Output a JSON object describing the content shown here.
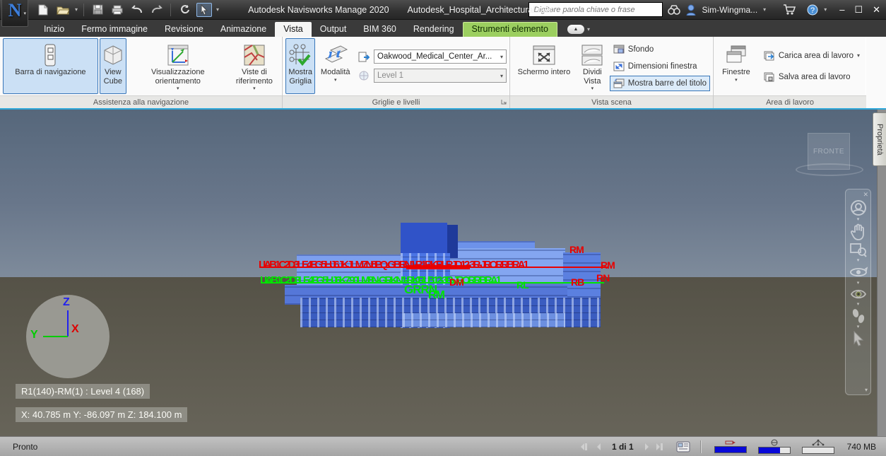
{
  "ui": {
    "caret": "▾",
    "up": "▲"
  },
  "titlebar": {
    "app_button": "N",
    "app_title": "Autodesk Navisworks Manage 2020",
    "doc_title": "Autodesk_Hospital_Architectural.nwc",
    "search_placeholder": "Digitare parola chiave o frase",
    "user_name": "Sim-Wingma...",
    "window_controls": {
      "minimize": "–",
      "maximize": "☐",
      "close": "✕"
    }
  },
  "tabs": [
    {
      "label": "Inizio"
    },
    {
      "label": "Fermo immagine"
    },
    {
      "label": "Revisione"
    },
    {
      "label": "Animazione"
    },
    {
      "label": "Vista",
      "state": "active"
    },
    {
      "label": "Output"
    },
    {
      "label": "BIM 360"
    },
    {
      "label": "Rendering"
    },
    {
      "label": "Strumenti elemento",
      "state": "highlighted"
    }
  ],
  "ribbon": {
    "panels": [
      {
        "label": "Assistenza alla navigazione",
        "buttons": [
          {
            "label": "Barra di navigazione",
            "active": true
          },
          {
            "label": "View Cube",
            "active": true
          },
          {
            "label": "Visualizzazione orientamento",
            "active": false
          },
          {
            "label": "Viste di riferimento",
            "active": false
          }
        ]
      },
      {
        "label": "Griglie e livelli",
        "buttons": [
          {
            "label": "Mostra Griglia",
            "active": true
          },
          {
            "label": "Modalità",
            "active": false
          }
        ],
        "combos": [
          {
            "value": "Oakwood_Medical_Center_Ar...",
            "disabled": false
          },
          {
            "value": "Level 1",
            "disabled": true
          }
        ]
      },
      {
        "label": "Vista scena",
        "buttons": [
          {
            "label": "Schermo intero",
            "active": false
          },
          {
            "label": "Dividi Vista",
            "active": false
          }
        ],
        "toggles": [
          {
            "label": "Sfondo",
            "active": false
          },
          {
            "label": "Dimensioni finestra",
            "active": false
          },
          {
            "label": "Mostra barre del titolo",
            "active": true
          }
        ]
      },
      {
        "label": "Area di lavoro",
        "buttons": [
          {
            "label": "Finestre",
            "active": false
          }
        ],
        "actions": [
          {
            "label": "Carica area di lavoro"
          },
          {
            "label": "Salva area di lavoro"
          }
        ]
      }
    ]
  },
  "viewport": {
    "viewcube_face": "FRONTE",
    "axis": {
      "x": "X",
      "y": "Y",
      "z": "Z"
    },
    "overlay_item": "R1(140)-RM(1) : Level 4 (168)",
    "overlay_coords": "X: 40.785 m  Y: -86.097 m  Z: 184.100 m",
    "properties_tab": "Proprietà",
    "grid_labels": {
      "red_row": "LIAB1C2D3LE4FG5HJ6JKJLM7N8PQ-GBRN1-R1RKRLRJD12-3R-JRORRBRA1",
      "green_row": "LIAB1C2D3LE4FG5HJ6K7.90LM8N-GRKN1-RKRLB12-3R-JRORRBRA1",
      "extras": [
        {
          "text": "RM",
          "color": "red"
        },
        {
          "text": "RM",
          "color": "red"
        },
        {
          "text": "RN",
          "color": "red"
        },
        {
          "text": "DM",
          "color": "red"
        },
        {
          "text": "GRRN",
          "color": "green"
        },
        {
          "text": "RM",
          "color": "green"
        },
        {
          "text": "RL",
          "color": "green"
        },
        {
          "text": "RB",
          "color": "red"
        }
      ]
    }
  },
  "statusbar": {
    "status": "Pronto",
    "page": "1 di 1",
    "memory": "740 MB"
  }
}
